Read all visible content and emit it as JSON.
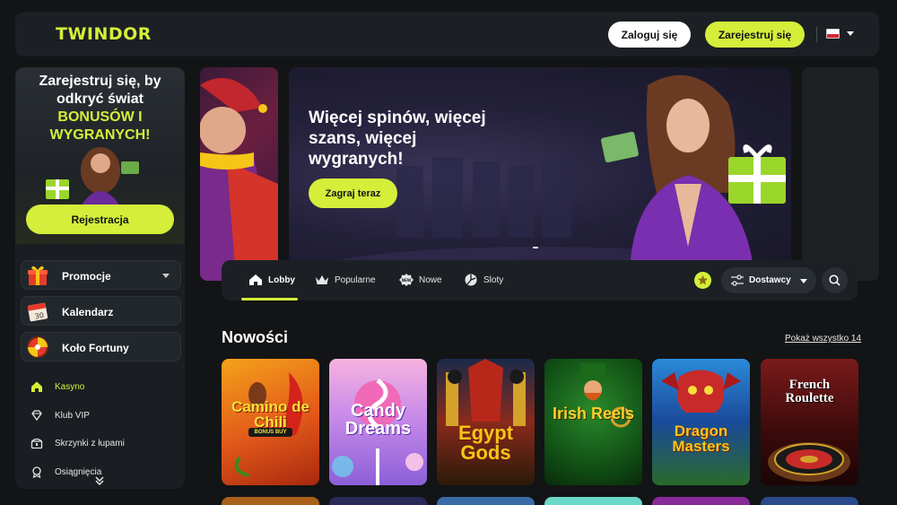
{
  "header": {
    "logo": "TWINDOR",
    "login_label": "Zaloguj się",
    "register_label": "Zarejestruj się",
    "language": "pl-flag"
  },
  "sidebar": {
    "promo": {
      "title": "Zarejestruj się, by odkryć świat",
      "highlight": "BONUSÓW I WYGRANYCH!",
      "button": "Rejestracja"
    },
    "menu": [
      {
        "label": "Promocje",
        "icon": "gift-icon"
      },
      {
        "label": "Kalendarz",
        "icon": "calendar-icon"
      },
      {
        "label": "Koło Fortuny",
        "icon": "wheel-icon"
      }
    ],
    "links": [
      {
        "label": "Kasyno",
        "icon": "home-icon"
      },
      {
        "label": "Klub VIP",
        "icon": "diamond-icon"
      },
      {
        "label": "Skrzynki z łupami",
        "icon": "chest-icon"
      },
      {
        "label": "Osiągnięcia",
        "icon": "achievement-icon"
      }
    ]
  },
  "banner": {
    "title": "Więcej spinów, więcej szans, więcej wygranych!",
    "button": "Zagraj teraz"
  },
  "tabs": [
    {
      "label": "Lobby",
      "icon": "home-icon",
      "active": true
    },
    {
      "label": "Popularne",
      "icon": "crown-icon"
    },
    {
      "label": "Nowe",
      "icon": "new-icon"
    },
    {
      "label": "Sloty",
      "icon": "slot-icon"
    }
  ],
  "providers_label": "Dostawcy",
  "section": {
    "title": "Nowości",
    "show_all": "Pokaż wszystko 14"
  },
  "games": [
    {
      "name": "Camino de Chili",
      "tag": "BONUS BUY"
    },
    {
      "name": "Candy Dreams"
    },
    {
      "name": "Egypt Gods"
    },
    {
      "name": "Irish Reels"
    },
    {
      "name": "Dragon Masters"
    },
    {
      "name": "French Roulette"
    }
  ],
  "colors": {
    "accent": "#d4ee3a",
    "background": "#121416",
    "panel": "#1c2024"
  }
}
